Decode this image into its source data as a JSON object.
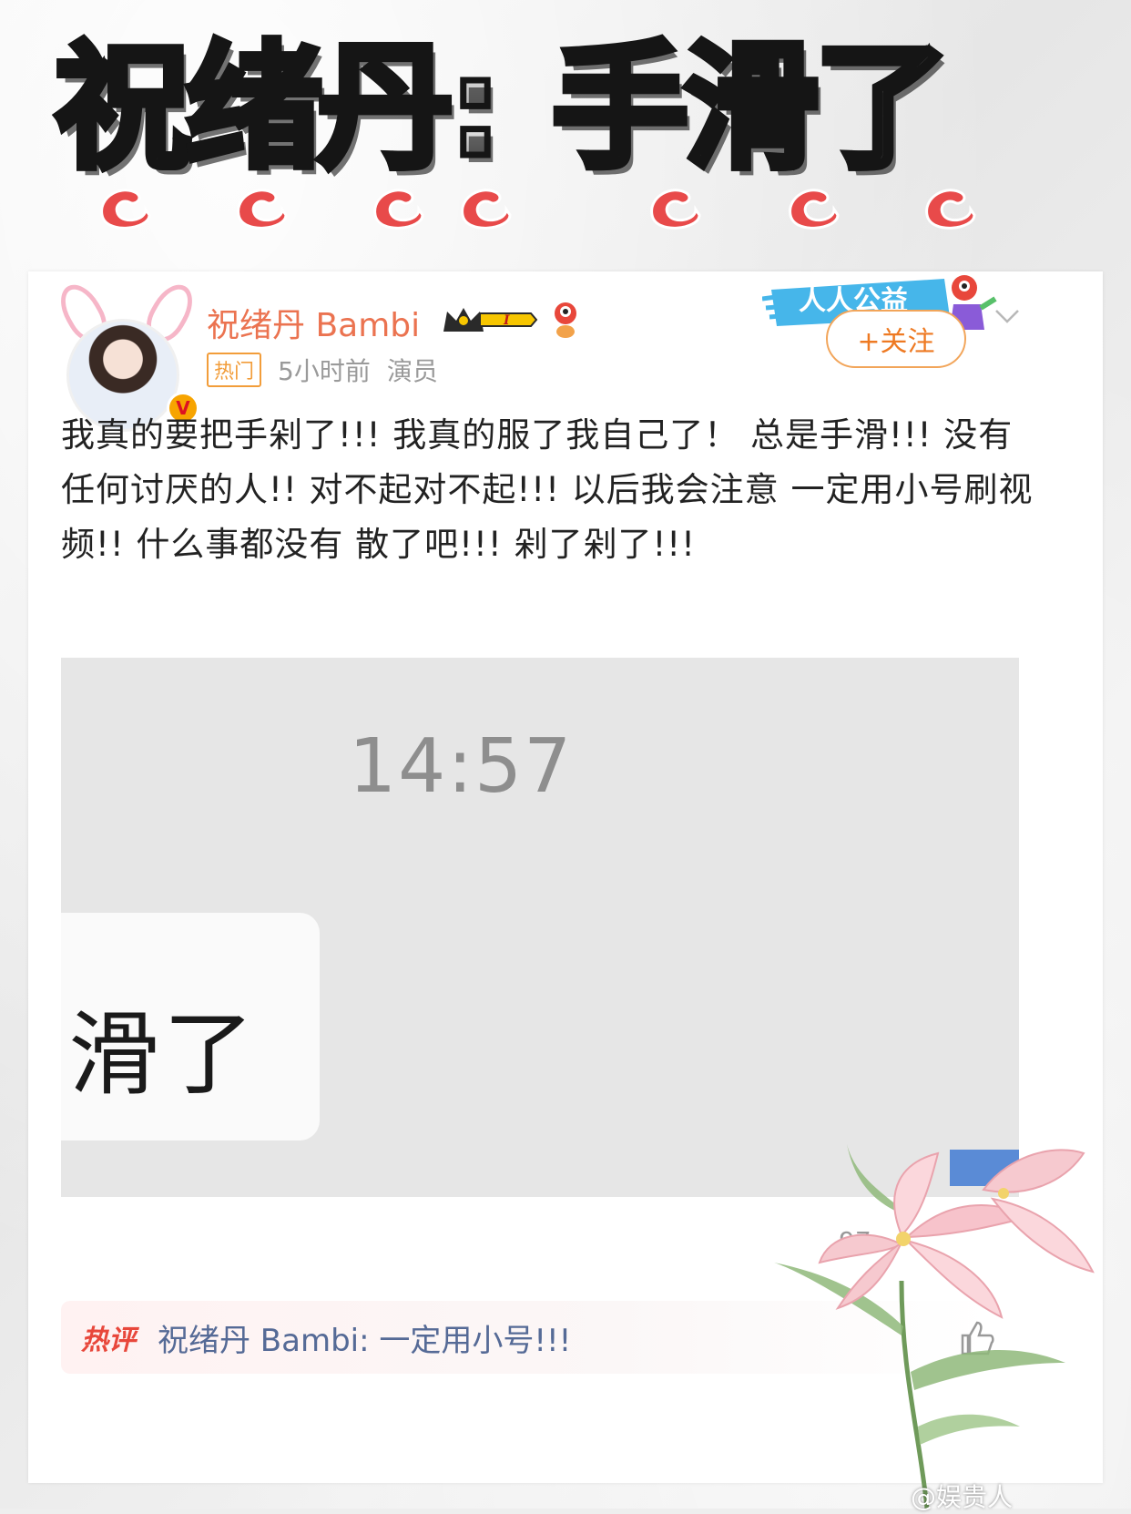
{
  "headline": {
    "part1": "祝绪丹:",
    "part2": "手滑了"
  },
  "post": {
    "user_name": "祝绪丹 Bambi",
    "level_badge": "I",
    "hot_tag": "热门",
    "time": "5小时前",
    "role": "演员",
    "public_banner": "人人公益",
    "follow_label": "+关注",
    "content": "我真的要把手剁了!!! 我真的服了我自己了！ 总是手滑!!! 没有任何讨厌的人!! 对不起对不起!!! 以后我会注意 一定用小号刷视频!! 什么事都没有 散了吧!!! 剁了剁了!!!",
    "screenshot_time": "14:57",
    "screenshot_bubble": "滑了",
    "partial_count": "97",
    "hot_comment_label": "热评",
    "hot_comment_text": "祝绪丹 Bambi: 一定用小号!!!"
  },
  "watermark": "@娱贵人",
  "colors": {
    "accent_orange": "#eb7350",
    "follow_orange": "#ee7a23",
    "hot_red": "#e8473b",
    "link_blue": "#556a96",
    "swirl_red": "#e84a4a"
  }
}
